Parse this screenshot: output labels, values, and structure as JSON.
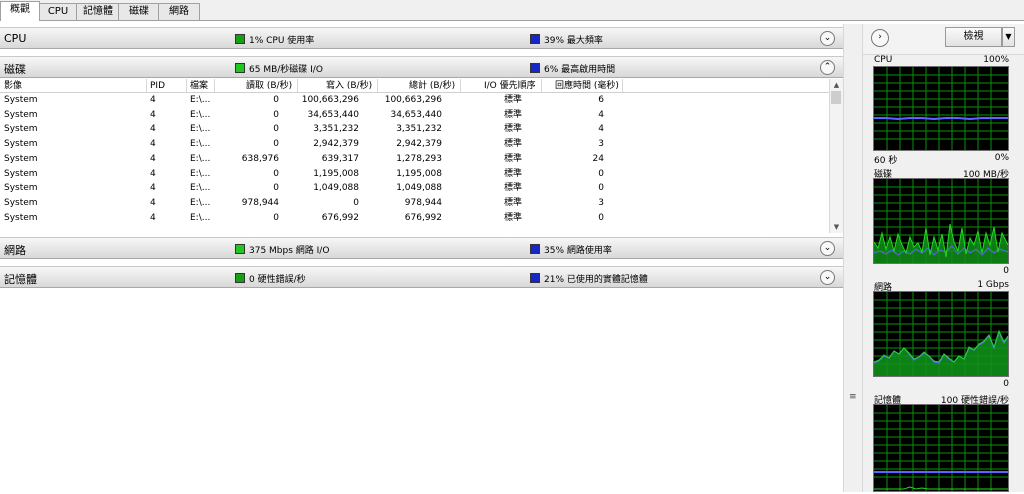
{
  "tabs": [
    "概觀",
    "CPU",
    "記憶體",
    "磁碟",
    "網路"
  ],
  "sections": {
    "cpu": {
      "title": "CPU",
      "metric1": "1% CPU 使用率",
      "metric2": "39% 最大頻率",
      "chevron": "expand"
    },
    "disk": {
      "title": "磁碟",
      "metric1": "65 MB/秒磁碟 I/O",
      "metric2": "6% 最高啟用時間",
      "chevron": "collapse"
    },
    "network": {
      "title": "網路",
      "metric1": "375 Mbps 網路 I/O",
      "metric2": "35% 網路使用率",
      "chevron": "expand"
    },
    "memory": {
      "title": "記憶體",
      "metric1": "0 硬性錯誤/秒",
      "metric2": "21% 已使用的實體記憶體",
      "chevron": "expand"
    }
  },
  "disk_table": {
    "columns": [
      "影像",
      "PID",
      "檔案",
      "讀取 (B/秒)",
      "寫入 (B/秒)",
      "總計 (B/秒)",
      "I/O 優先順序",
      "回應時間 (毫秒)"
    ],
    "rows": [
      [
        "System",
        "4",
        "E:\\...",
        "0",
        "100,663,296",
        "100,663,296",
        "標準",
        "6"
      ],
      [
        "System",
        "4",
        "E:\\...",
        "0",
        "34,653,440",
        "34,653,440",
        "標準",
        "4"
      ],
      [
        "System",
        "4",
        "E:\\...",
        "0",
        "3,351,232",
        "3,351,232",
        "標準",
        "4"
      ],
      [
        "System",
        "4",
        "E:\\...",
        "0",
        "2,942,379",
        "2,942,379",
        "標準",
        "3"
      ],
      [
        "System",
        "4",
        "E:\\...",
        "638,976",
        "639,317",
        "1,278,293",
        "標準",
        "24"
      ],
      [
        "System",
        "4",
        "E:\\...",
        "0",
        "1,195,008",
        "1,195,008",
        "標準",
        "0"
      ],
      [
        "System",
        "4",
        "E:\\...",
        "0",
        "1,049,088",
        "1,049,088",
        "標準",
        "0"
      ],
      [
        "System",
        "4",
        "E:\\...",
        "978,944",
        "0",
        "978,944",
        "標準",
        "3"
      ],
      [
        "System",
        "4",
        "E:\\...",
        "0",
        "676,992",
        "676,992",
        "標準",
        "0"
      ]
    ]
  },
  "right_panel": {
    "view_label": "檢視",
    "graphs": [
      {
        "title": "CPU",
        "max": "100%",
        "foot_left": "60 秒",
        "foot_right": "0%"
      },
      {
        "title": "磁碟",
        "max": "100 MB/秒",
        "foot_left": "",
        "foot_right": "0"
      },
      {
        "title": "網路",
        "max": "1 Gbps",
        "foot_left": "",
        "foot_right": "0"
      },
      {
        "title": "記憶體",
        "max": "100 硬性錯誤/秒",
        "foot_left": "",
        "foot_right": ""
      }
    ]
  },
  "colors": {
    "metric1": "#14a014",
    "metric2": "#1626c8",
    "graph_bg": "#000000",
    "graph_grid": "#0b8f0b",
    "graph_green": "#22d922",
    "graph_blue": "#5b64ff"
  }
}
